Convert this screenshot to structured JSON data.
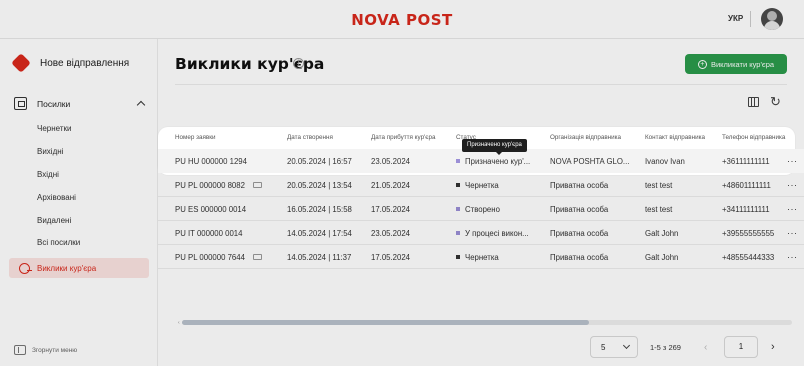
{
  "header": {
    "logo": "NOVA POST",
    "lang": "УКР"
  },
  "sidebar": {
    "new_shipment": "Нове відправлення",
    "parcels_section": "Посилки",
    "items": [
      "Чернетки",
      "Вихідні",
      "Вхідні",
      "Архівовані",
      "Видалені",
      "Всі посилки"
    ],
    "active": "Виклики кур'єра",
    "collapse": "Згорнути меню"
  },
  "main": {
    "title": "Виклики кур'єра",
    "info": "i",
    "call_button": "Викликати кур'єра",
    "columns": [
      "Номер заявки",
      "Дата створення",
      "Дата прибуття кур'єра",
      "Статус",
      "Організація відправника",
      "Контакт відправника",
      "Телефон відправника"
    ],
    "rows": [
      {
        "num": "PU HU 000000 1294",
        "created": "20.05.2024 | 16:57",
        "arrival": "23.05.2024",
        "status": "Призначено кур'...",
        "status_color": "#9b8fd6",
        "org": "NOVA POSHTA GLO...",
        "contact": "Ivanov Ivan",
        "phone": "+36111111111",
        "doc": false
      },
      {
        "num": "PU PL 000000 8082",
        "created": "20.05.2024 | 13:54",
        "arrival": "21.05.2024",
        "status": "Чернетка",
        "status_color": "#333333",
        "org": "Приватна особа",
        "contact": "test test",
        "phone": "+48601111111",
        "doc": true
      },
      {
        "num": "PU ES 000000 0014",
        "created": "16.05.2024 | 15:58",
        "arrival": "17.05.2024",
        "status": "Створено",
        "status_color": "#9b8fd6",
        "org": "Приватна особа",
        "contact": "test test",
        "phone": "+34111111111",
        "doc": false
      },
      {
        "num": "PU IT 000000 0014",
        "created": "14.05.2024 | 17:54",
        "arrival": "23.05.2024",
        "status": "У процесі викон...",
        "status_color": "#9b8fd6",
        "org": "Приватна особа",
        "contact": "Galt John",
        "phone": "+39555555555",
        "doc": false
      },
      {
        "num": "PU PL 000000 7644",
        "created": "14.05.2024 | 11:37",
        "arrival": "17.05.2024",
        "status": "Чернетка",
        "status_color": "#333333",
        "org": "Приватна особа",
        "contact": "Galt John",
        "phone": "+48555444333",
        "doc": true
      }
    ],
    "more": "···",
    "tooltip": "Призначено кур'єра"
  },
  "pagination": {
    "page_size": "5",
    "range": "1-5 з 269",
    "page": "1"
  }
}
